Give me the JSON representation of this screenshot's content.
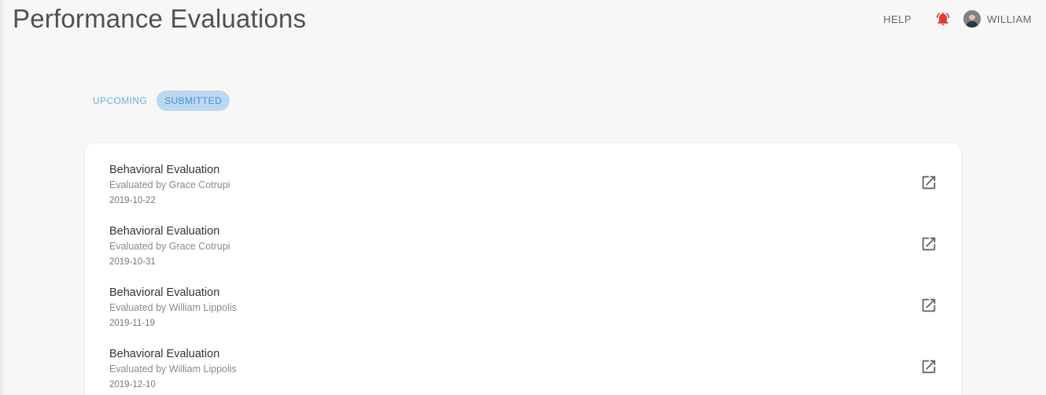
{
  "header": {
    "title": "Performance Evaluations",
    "help_label": "HELP",
    "notification_icon": "bell-icon",
    "notification_color": "#e53935",
    "user_name": "WILLIAM"
  },
  "tabs": [
    {
      "label": "UPCOMING",
      "active": false
    },
    {
      "label": "SUBMITTED",
      "active": true
    }
  ],
  "evaluations": [
    {
      "title": "Behavioral Evaluation",
      "evaluator": "Evaluated by Grace Cotrupi",
      "date": "2019-10-22"
    },
    {
      "title": "Behavioral Evaluation",
      "evaluator": "Evaluated by Grace Cotrupi",
      "date": "2019-10-31"
    },
    {
      "title": "Behavioral Evaluation",
      "evaluator": "Evaluated by William Lippolis",
      "date": "2019-11-19"
    },
    {
      "title": "Behavioral Evaluation",
      "evaluator": "Evaluated by William Lippolis",
      "date": "2019-12-10"
    }
  ],
  "colors": {
    "accent": "#4a90d2",
    "tab_active_bg": "#bcd8f1",
    "background": "#f7f7f7"
  }
}
